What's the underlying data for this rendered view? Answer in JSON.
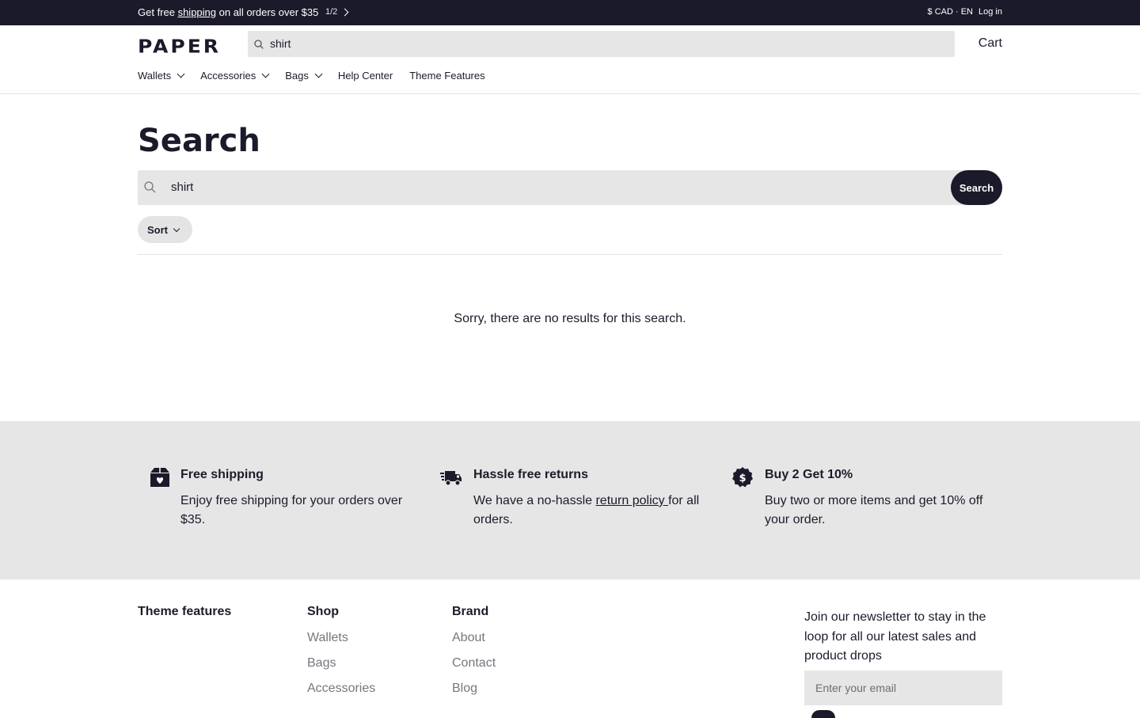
{
  "announcement": {
    "prefix": "Get free ",
    "link": "shipping",
    "suffix": " on all orders over $35",
    "pager": "1/2",
    "currency": "$ CAD · EN",
    "login": "Log in"
  },
  "header": {
    "logo": "PAPER",
    "search_value": "shirt",
    "cart": "Cart",
    "nav": [
      {
        "label": "Wallets",
        "dropdown": true
      },
      {
        "label": "Accessories",
        "dropdown": true
      },
      {
        "label": "Bags",
        "dropdown": true
      },
      {
        "label": "Help Center",
        "dropdown": false
      },
      {
        "label": "Theme Features",
        "dropdown": false
      }
    ]
  },
  "main": {
    "title": "Search",
    "search_value": "shirt",
    "search_button": "Search",
    "sort_label": "Sort",
    "empty_message": "Sorry, there are no results for this search."
  },
  "features": [
    {
      "icon": "box-heart-icon",
      "title": "Free shipping",
      "desc": "Enjoy free shipping for your orders over $35."
    },
    {
      "icon": "delivery-truck-icon",
      "title": "Hassle free returns",
      "desc_pre": "We have a no-hassle ",
      "desc_link": "return policy ",
      "desc_post": "for all orders."
    },
    {
      "icon": "dollar-badge-icon",
      "title": "Buy 2 Get 10%",
      "desc": "Buy two or more items and get 10% off your order."
    }
  ],
  "footer": {
    "theme_features": "Theme features",
    "shop": {
      "title": "Shop",
      "links": [
        "Wallets",
        "Bags",
        "Accessories"
      ]
    },
    "brand": {
      "title": "Brand",
      "links": [
        "About",
        "Contact",
        "Blog"
      ]
    },
    "newsletter_text": "Join our newsletter to stay in the loop for all our latest sales and product drops",
    "email_placeholder": "Enter your email"
  },
  "colors": {
    "dark": "#1a1a2a",
    "band": "#e6e6e6",
    "muted_link": "#77777f"
  }
}
